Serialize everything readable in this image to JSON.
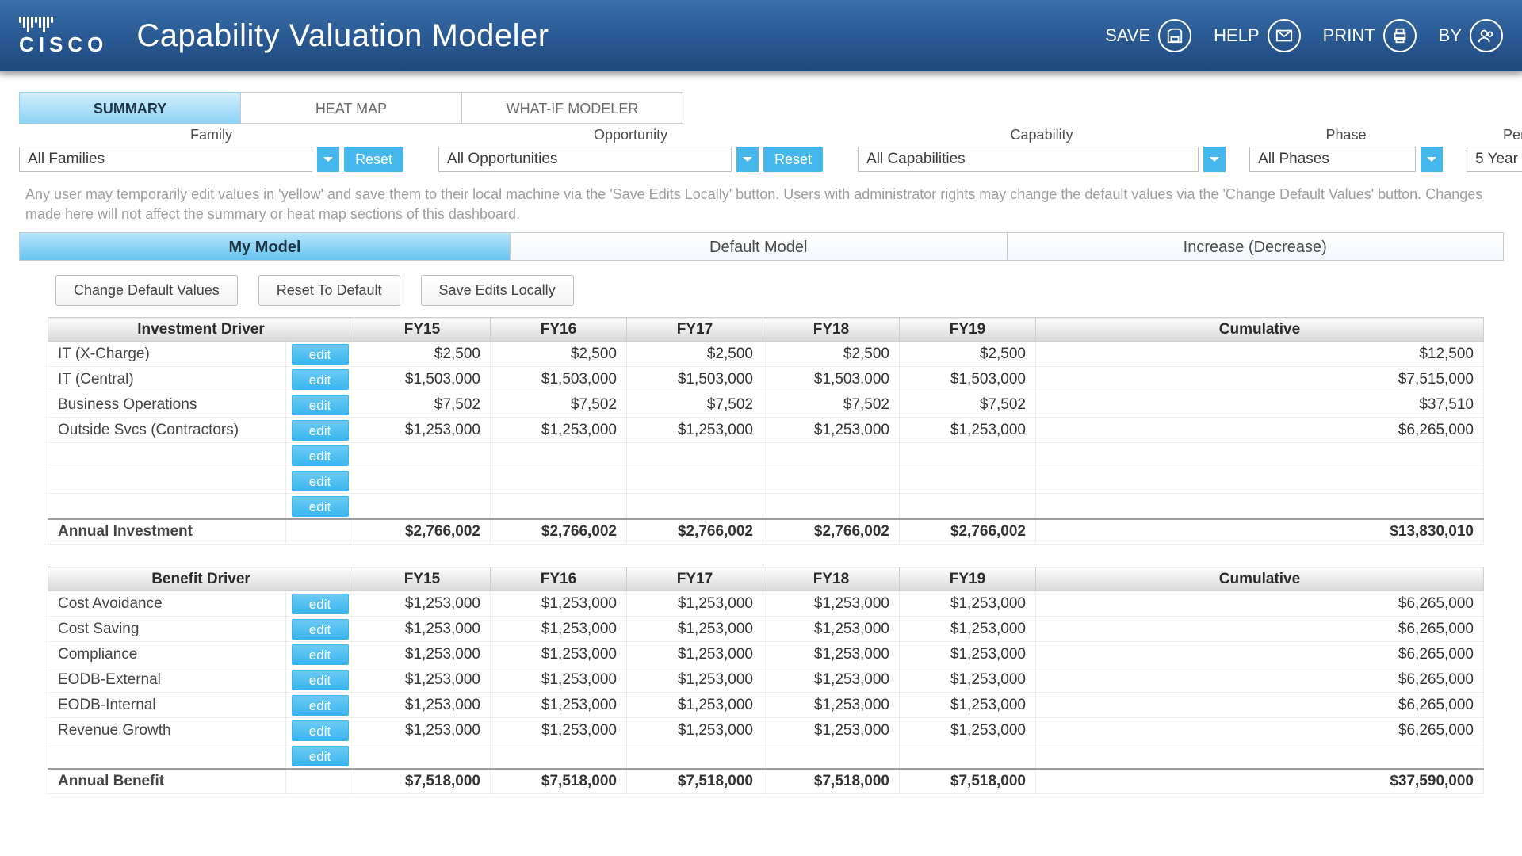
{
  "header": {
    "app_title": "Capability Valuation Modeler",
    "logo_text": "CISCO",
    "save": "SAVE",
    "help": "HELP",
    "print": "PRINT",
    "by": "BY"
  },
  "tabs": {
    "summary": "SUMMARY",
    "heatmap": "HEAT MAP",
    "whatif": "WHAT-IF MODELER"
  },
  "filters": {
    "family_label": "Family",
    "family_value": "All Families",
    "opportunity_label": "Opportunity",
    "opportunity_value": "All Opportunities",
    "capability_label": "Capability",
    "capability_value": "All Capabilities",
    "phase_label": "Phase",
    "phase_value": "All Phases",
    "period_label": "Period",
    "period_value": "5 Year",
    "reset": "Reset"
  },
  "info_text": "Any user may temporarily edit values in 'yellow' and save them to their local machine via the 'Save Edits Locally' button.  Users with administrator rights may change the default values via the 'Change Default Values' button.  Changes made here will not affect the summary or heat map sections of this dashboard.",
  "model_tabs": {
    "my_model": "My Model",
    "default_model": "Default Model",
    "increase_decrease": "Increase (Decrease)"
  },
  "actions": {
    "change_defaults": "Change Default Values",
    "reset_default": "Reset To Default",
    "save_local": "Save Edits Locally"
  },
  "edit_label": "edit",
  "columns": {
    "investment_driver": "Investment Driver",
    "benefit_driver": "Benefit Driver",
    "fy15": "FY15",
    "fy16": "FY16",
    "fy17": "FY17",
    "fy18": "FY18",
    "fy19": "FY19",
    "cumulative": "Cumulative"
  },
  "investment": {
    "rows": [
      {
        "label": "IT (X-Charge)",
        "v": [
          "$2,500",
          "$2,500",
          "$2,500",
          "$2,500",
          "$2,500"
        ],
        "cum": "$12,500"
      },
      {
        "label": "IT (Central)",
        "v": [
          "$1,503,000",
          "$1,503,000",
          "$1,503,000",
          "$1,503,000",
          "$1,503,000"
        ],
        "cum": "$7,515,000"
      },
      {
        "label": "Business Operations",
        "v": [
          "$7,502",
          "$7,502",
          "$7,502",
          "$7,502",
          "$7,502"
        ],
        "cum": "$37,510"
      },
      {
        "label": "Outside Svcs (Contractors)",
        "v": [
          "$1,253,000",
          "$1,253,000",
          "$1,253,000",
          "$1,253,000",
          "$1,253,000"
        ],
        "cum": "$6,265,000"
      },
      {
        "label": "",
        "v": [
          "",
          "",
          "",
          "",
          ""
        ],
        "cum": ""
      },
      {
        "label": "",
        "v": [
          "",
          "",
          "",
          "",
          ""
        ],
        "cum": ""
      },
      {
        "label": "",
        "v": [
          "",
          "",
          "",
          "",
          ""
        ],
        "cum": ""
      }
    ],
    "total_label": "Annual Investment",
    "total": [
      "$2,766,002",
      "$2,766,002",
      "$2,766,002",
      "$2,766,002",
      "$2,766,002"
    ],
    "total_cum": "$13,830,010"
  },
  "benefit": {
    "rows": [
      {
        "label": "Cost Avoidance",
        "v": [
          "$1,253,000",
          "$1,253,000",
          "$1,253,000",
          "$1,253,000",
          "$1,253,000"
        ],
        "cum": "$6,265,000"
      },
      {
        "label": "Cost Saving",
        "v": [
          "$1,253,000",
          "$1,253,000",
          "$1,253,000",
          "$1,253,000",
          "$1,253,000"
        ],
        "cum": "$6,265,000"
      },
      {
        "label": "Compliance",
        "v": [
          "$1,253,000",
          "$1,253,000",
          "$1,253,000",
          "$1,253,000",
          "$1,253,000"
        ],
        "cum": "$6,265,000"
      },
      {
        "label": "EODB-External",
        "v": [
          "$1,253,000",
          "$1,253,000",
          "$1,253,000",
          "$1,253,000",
          "$1,253,000"
        ],
        "cum": "$6,265,000"
      },
      {
        "label": "EODB-Internal",
        "v": [
          "$1,253,000",
          "$1,253,000",
          "$1,253,000",
          "$1,253,000",
          "$1,253,000"
        ],
        "cum": "$6,265,000"
      },
      {
        "label": "Revenue Growth",
        "v": [
          "$1,253,000",
          "$1,253,000",
          "$1,253,000",
          "$1,253,000",
          "$1,253,000"
        ],
        "cum": "$6,265,000"
      },
      {
        "label": "",
        "v": [
          "",
          "",
          "",
          "",
          ""
        ],
        "cum": ""
      }
    ],
    "total_label": "Annual Benefit",
    "total": [
      "$7,518,000",
      "$7,518,000",
      "$7,518,000",
      "$7,518,000",
      "$7,518,000"
    ],
    "total_cum": "$37,590,000"
  }
}
